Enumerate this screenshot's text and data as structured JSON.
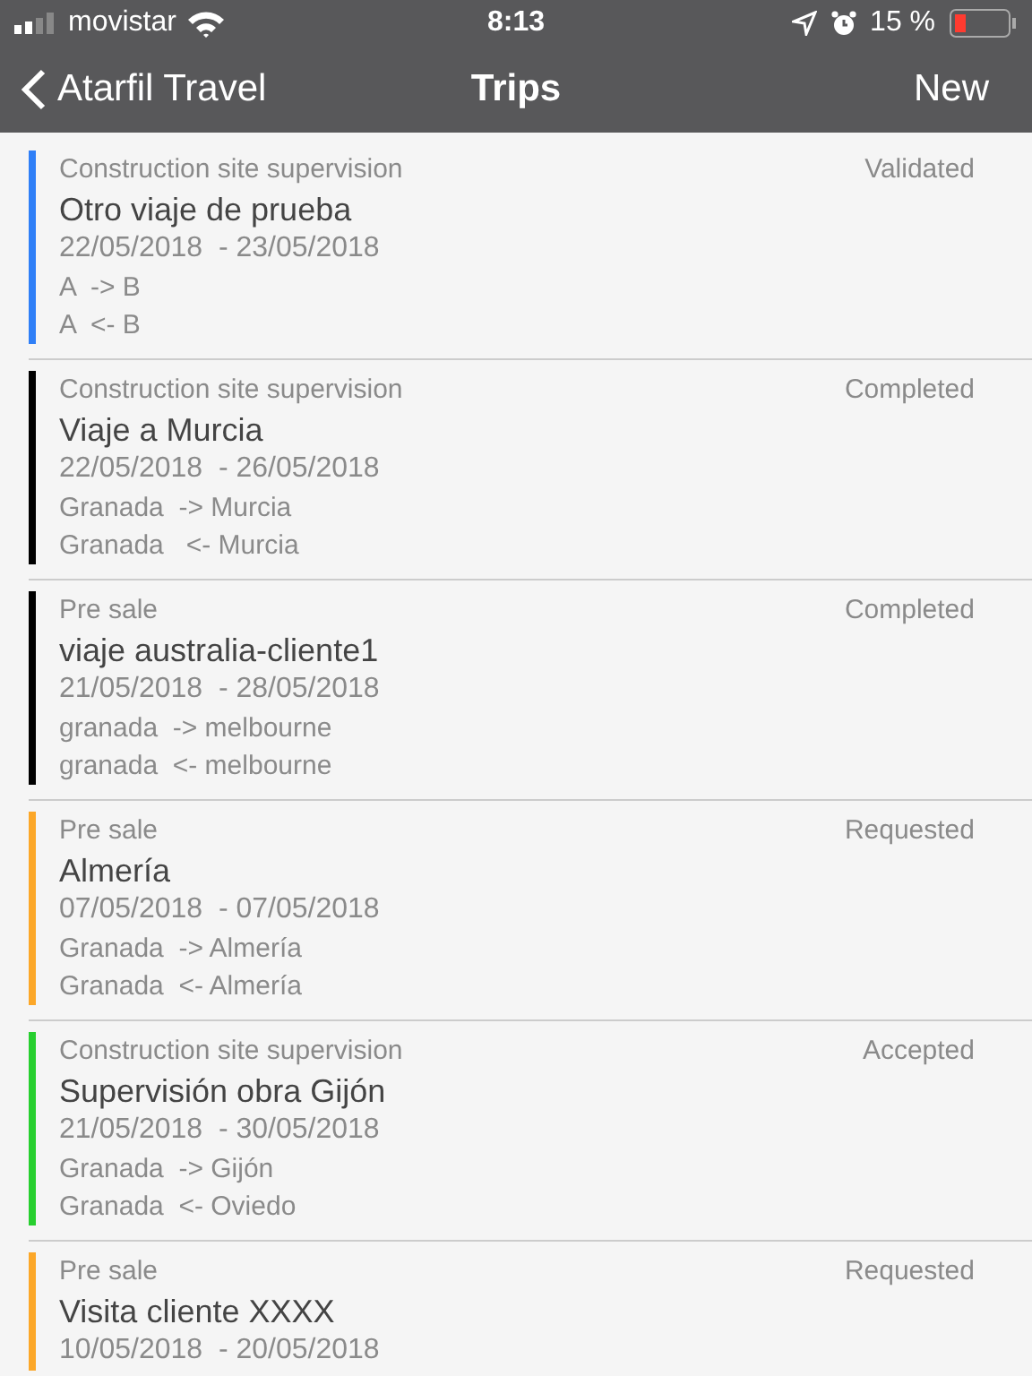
{
  "status_bar": {
    "carrier": "movistar",
    "time": "8:13",
    "battery": "15 %"
  },
  "nav": {
    "back": "Atarfil Travel",
    "title": "Trips",
    "action": "New"
  },
  "trips": [
    {
      "category": "Construction site supervision",
      "status": "Validated",
      "color": "#2f7ff7",
      "title": "Otro viaje de prueba",
      "dates": "22/05/2018  - 23/05/2018",
      "routes": [
        "A  -> B",
        "A  <- B"
      ]
    },
    {
      "category": "Construction site supervision",
      "status": "Completed",
      "color": "#000000",
      "title": "Viaje a Murcia",
      "dates": "22/05/2018  - 26/05/2018",
      "routes": [
        "Granada  -> Murcia",
        "Granada   <- Murcia"
      ]
    },
    {
      "category": "Pre sale",
      "status": "Completed",
      "color": "#000000",
      "title": "viaje australia-cliente1",
      "dates": "21/05/2018  - 28/05/2018",
      "routes": [
        "granada  -> melbourne",
        "granada  <- melbourne"
      ]
    },
    {
      "category": "Pre sale",
      "status": "Requested",
      "color": "#fca728",
      "title": "Almería",
      "dates": "07/05/2018  - 07/05/2018",
      "routes": [
        "Granada  -> Almería",
        "Granada  <- Almería"
      ]
    },
    {
      "category": "Construction site supervision",
      "status": "Accepted",
      "color": "#27cf2f",
      "title": "Supervisión obra Gijón",
      "dates": "21/05/2018  - 30/05/2018",
      "routes": [
        "Granada  -> Gijón",
        "Granada  <- Oviedo"
      ]
    },
    {
      "category": "Pre sale",
      "status": "Requested",
      "color": "#fca728",
      "title": "Visita cliente XXXX",
      "dates": "10/05/2018  - 20/05/2018"
    }
  ]
}
